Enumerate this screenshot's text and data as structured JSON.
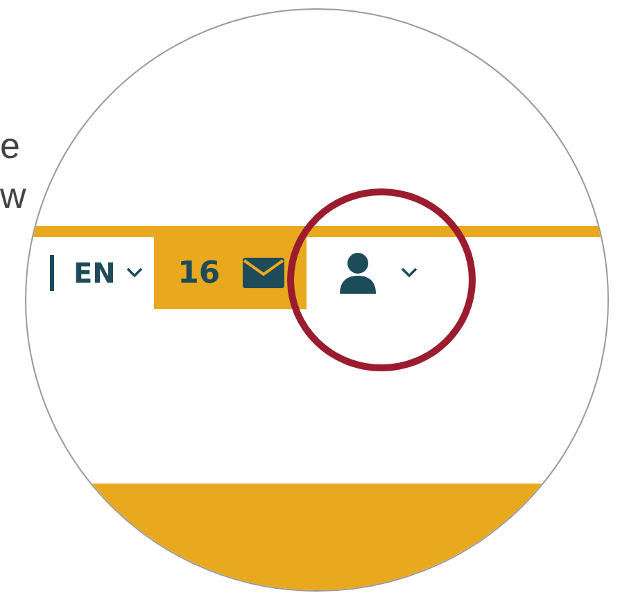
{
  "background_text": [
    {
      "text": "e"
    },
    {
      "text": "w"
    }
  ],
  "header": {
    "language": "EN",
    "message_count": "16"
  }
}
